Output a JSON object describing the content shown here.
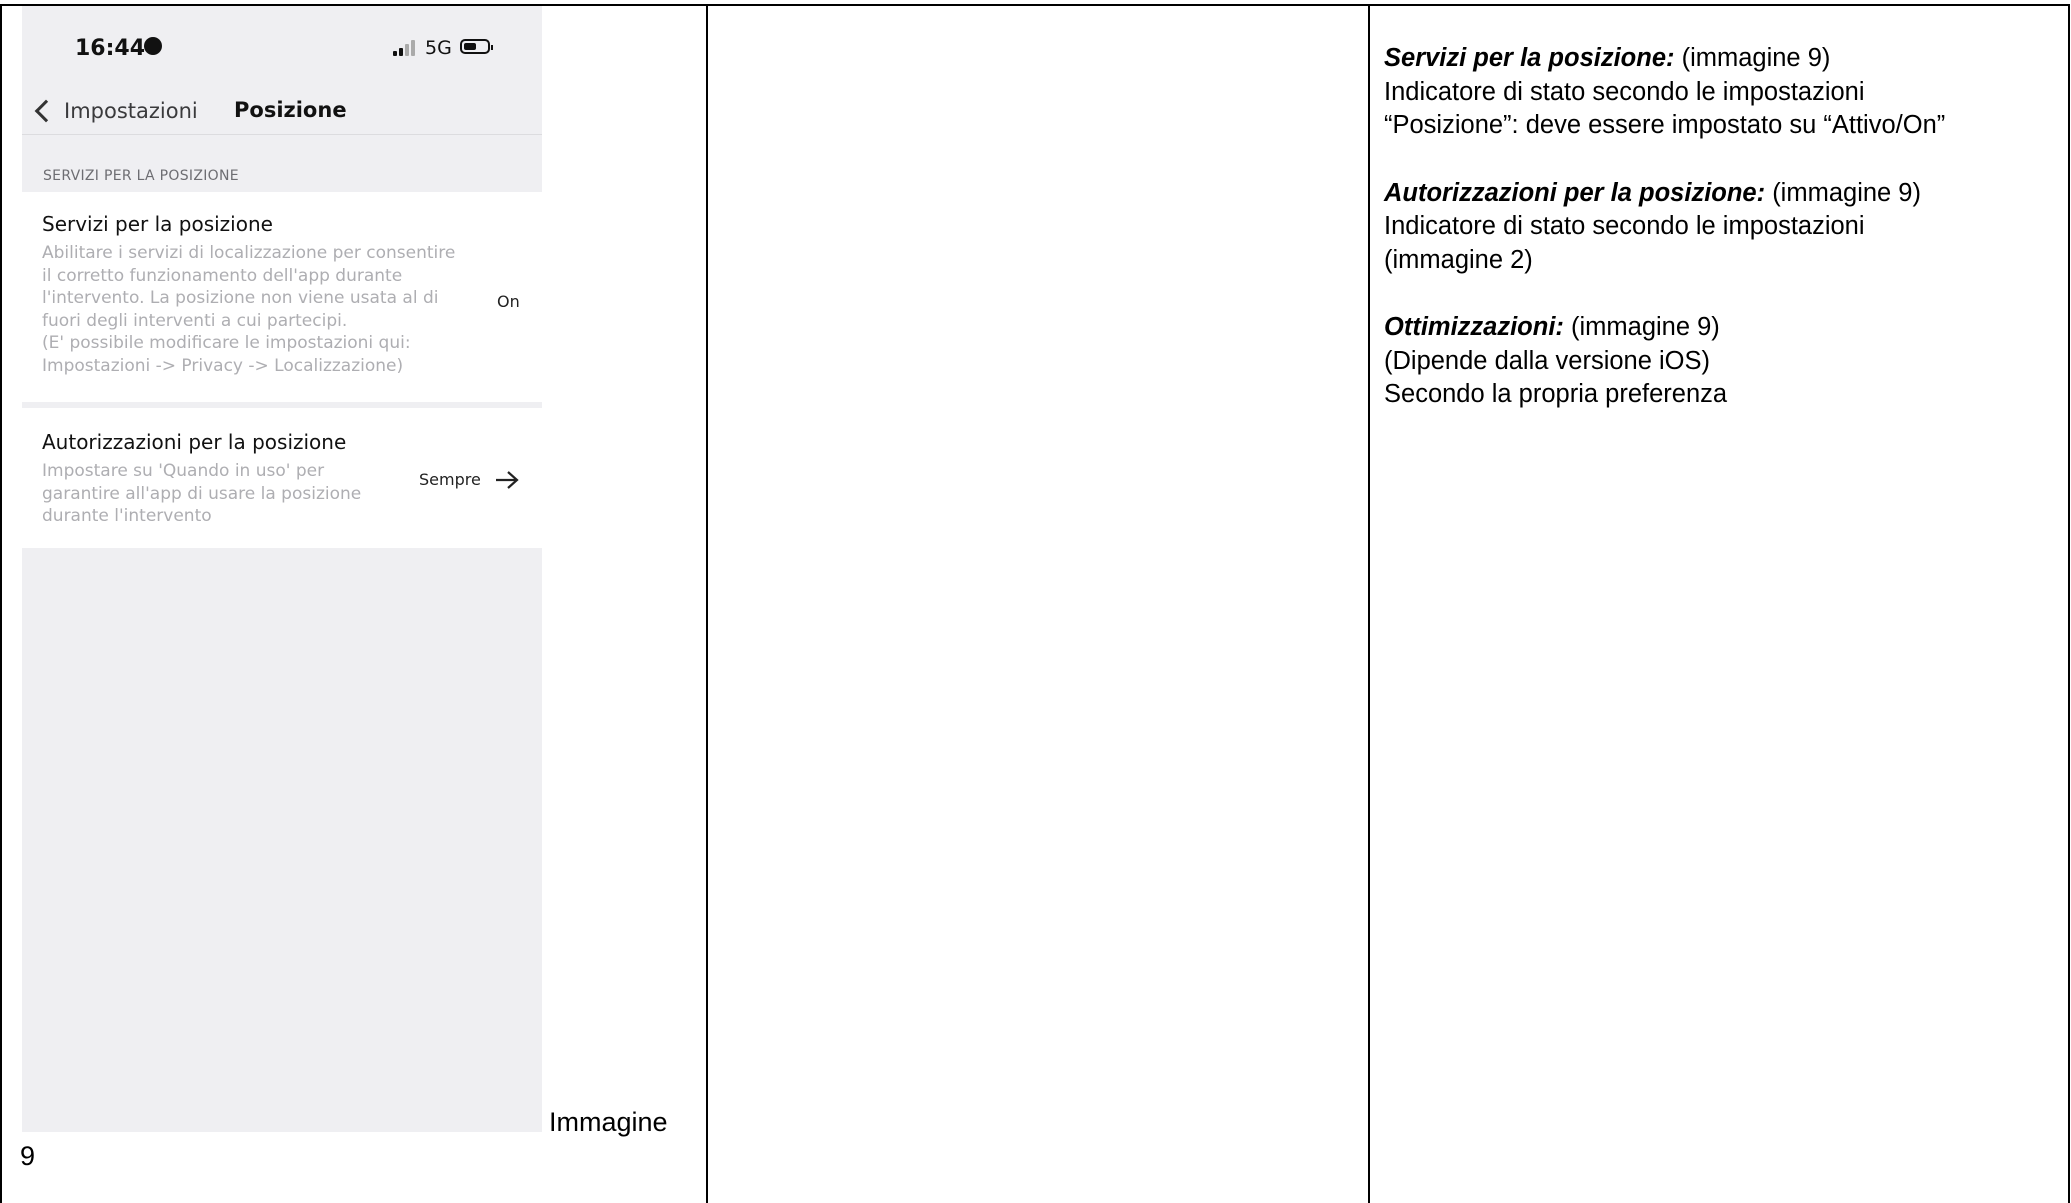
{
  "phone": {
    "status_time": "16:44",
    "network": "5G",
    "back_label": "Impostazioni",
    "title": "Posizione",
    "section_header": "SERVIZI PER LA POSIZIONE",
    "row1": {
      "title": "Servizi per la posizione",
      "description": "Abilitare i servizi di localizzazione per consentire\nil corretto funzionamento dell'app durante\nl'intervento. La posizione non viene usata al di\nfuori degli interventi a cui partecipi.\n(E' possibile modificare le impostazioni qui:\nImpostazioni -> Privacy -> Localizzazione)",
      "value": "On"
    },
    "row2": {
      "title": "Autorizzazioni per la posizione",
      "description": "Impostare su 'Quando in uso' per\ngarantire all'app di usare la posizione\ndurante l'intervento",
      "value": "Sempre"
    }
  },
  "caption": {
    "part1": "Immagine",
    "part2": "9"
  },
  "notes": [
    {
      "heading": "Servizi per la posizione:",
      "suffix": " (immagine 9)",
      "lines": [
        "Indicatore di stato secondo le impostazioni",
        "“Posizione”: deve essere impostato su “Attivo/On”"
      ]
    },
    {
      "heading": "Autorizzazioni per la posizione:",
      "suffix": " (immagine 9)",
      "lines": [
        "Indicatore di stato secondo le impostazioni",
        "(immagine 2)"
      ]
    },
    {
      "heading": "Ottimizzazioni:",
      "suffix": " (immagine 9)",
      "lines": [
        "(Dipende dalla versione iOS)",
        "Secondo la propria preferenza"
      ]
    }
  ]
}
